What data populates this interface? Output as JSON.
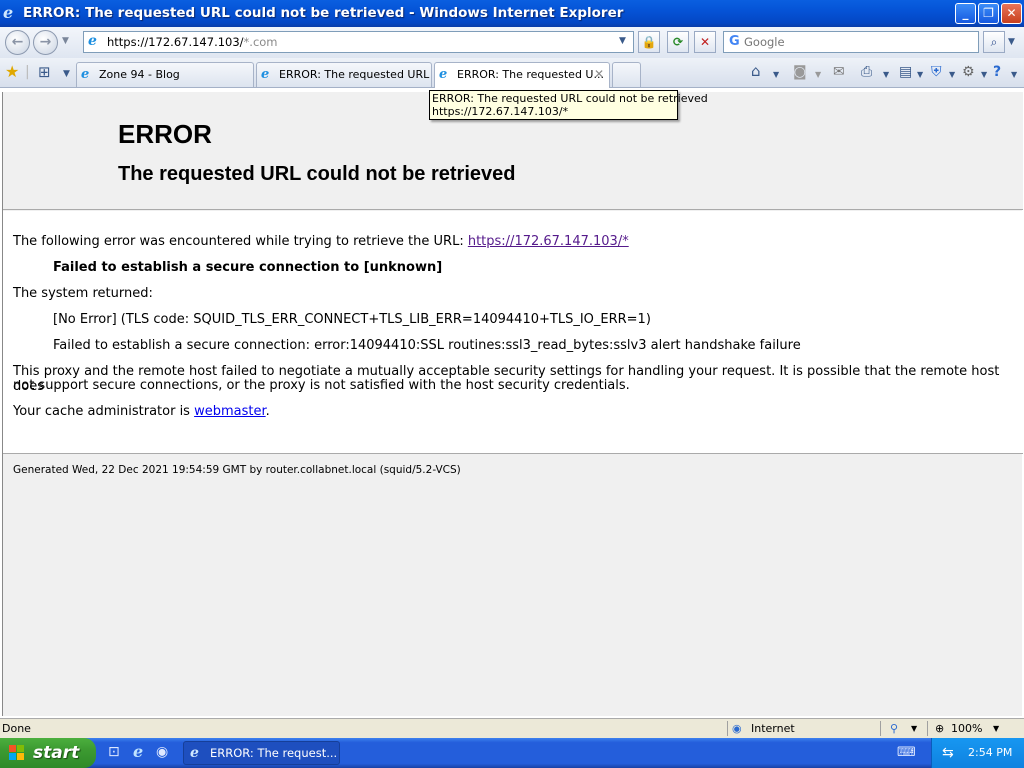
{
  "window": {
    "title": "ERROR: The requested URL could not be retrieved - Windows Internet Explorer",
    "minimize": "_",
    "restore": "❐",
    "close": "✕"
  },
  "nav": {
    "back_icon": "←",
    "forward_icon": "→",
    "address_main": "https://172.67.147.103/",
    "address_rest": "*.com",
    "search_placeholder": "Google"
  },
  "tabs": [
    {
      "label": "Zone 94 - Blog"
    },
    {
      "label": "ERROR: The requested URL ..."
    },
    {
      "label": "ERROR: The requested U..."
    }
  ],
  "tooltip": {
    "line1": "ERROR: The requested URL could not be retrieved",
    "line2": "https://172.67.147.103/*"
  },
  "page": {
    "h1": "ERROR",
    "h2": "The requested URL could not be retrieved",
    "p1_text": "The following error was encountered while trying to retrieve the URL: ",
    "p1_link": "https://172.67.147.103/*",
    "p2": "Failed to establish a secure connection to [unknown]",
    "p3": "The system returned:",
    "p4": "[No Error] (TLS code: SQUID_TLS_ERR_CONNECT+TLS_LIB_ERR=14094410+TLS_IO_ERR=1)",
    "p5": "Failed to establish a secure connection: error:14094410:SSL routines:ssl3_read_bytes:sslv3 alert handshake failure",
    "p6_a": "This proxy and the remote host failed to negotiate a mutually acceptable security settings for handling your request. It is possible that the remote host does",
    "p6_b": "not support secure connections, or the proxy is not satisfied with the host security credentials.",
    "p7_text": "Your cache administrator is ",
    "p7_link": "webmaster",
    "p7_end": ".",
    "generated": "Generated Wed, 22 Dec 2021 19:54:59 GMT by router.collabnet.local (squid/5.2-VCS)"
  },
  "status": {
    "left": "Done",
    "zone": "Internet",
    "zoom": "100%"
  },
  "taskbar": {
    "start": "start",
    "task": "ERROR: The request...",
    "clock": "2:54 PM"
  }
}
